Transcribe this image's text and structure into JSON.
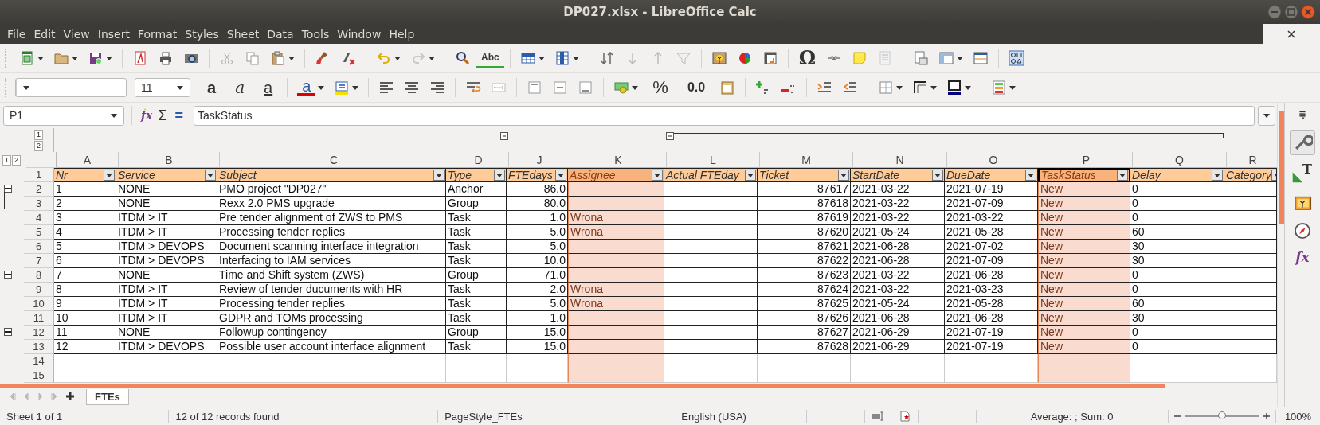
{
  "window": {
    "title": "DP027.xlsx - LibreOffice Calc"
  },
  "menu": [
    "File",
    "Edit",
    "View",
    "Insert",
    "Format",
    "Styles",
    "Sheet",
    "Data",
    "Tools",
    "Window",
    "Help"
  ],
  "standard_toolbar": {
    "glyphs": [
      "Abc",
      "Ω"
    ]
  },
  "formatting_toolbar": {
    "font_size": "11",
    "glyphs": [
      "a",
      "a",
      "a",
      "a",
      "%",
      "0.0"
    ]
  },
  "formula_bar": {
    "name_box": "P1",
    "glyphs": [
      "fx",
      "Σ",
      "="
    ],
    "content": "TaskStatus"
  },
  "outline_levels": {
    "columns": [
      "1",
      "2"
    ],
    "rows": [
      "1",
      "2"
    ]
  },
  "table": {
    "columns": [
      {
        "letter": "A",
        "header": "Nr",
        "numeric": false,
        "highlighted": false,
        "selected": false
      },
      {
        "letter": "B",
        "header": "Service",
        "numeric": false,
        "highlighted": false,
        "selected": false
      },
      {
        "letter": "C",
        "header": "Subject",
        "numeric": false,
        "highlighted": false,
        "selected": false
      },
      {
        "letter": "D",
        "header": "Type",
        "numeric": false,
        "highlighted": false,
        "selected": false
      },
      {
        "letter": "J",
        "header": "FTEdays",
        "numeric": true,
        "highlighted": false,
        "selected": false,
        "group_toggle": true
      },
      {
        "letter": "K",
        "header": "Assignee",
        "numeric": false,
        "highlighted": true,
        "selected": false
      },
      {
        "letter": "L",
        "header": "Actual FTEday",
        "highlighted": false,
        "selected": false,
        "group_toggle": true,
        "group_line": true
      },
      {
        "letter": "M",
        "header": "Ticket",
        "numeric": true,
        "highlighted": false,
        "selected": false,
        "group_line": true
      },
      {
        "letter": "N",
        "header": "StartDate",
        "numeric": false,
        "highlighted": false,
        "selected": false,
        "group_line": true
      },
      {
        "letter": "O",
        "header": "DueDate",
        "numeric": false,
        "highlighted": false,
        "selected": false,
        "group_line": true
      },
      {
        "letter": "P",
        "header": "TaskStatus",
        "numeric": false,
        "highlighted": true,
        "selected": true,
        "group_line": true
      },
      {
        "letter": "Q",
        "header": "Delay",
        "numeric": false,
        "highlighted": false,
        "selected": false,
        "group_line": true
      },
      {
        "letter": "R",
        "header": "Category",
        "highlighted": false,
        "selected": false
      }
    ],
    "header_row": "1",
    "rows": [
      {
        "number": "2",
        "group_toggle": true,
        "cells": [
          "1",
          "NONE",
          "PMO project \"DP027\"",
          "Anchor",
          "86.0",
          "",
          "",
          "87617",
          "2021-03-22",
          "2021-07-19",
          "New",
          "0",
          ""
        ]
      },
      {
        "number": "3",
        "group_line": true,
        "cells": [
          "2",
          "NONE",
          "Rexx 2.0 PMS upgrade",
          "Group",
          "80.0",
          "",
          "",
          "87618",
          "2021-03-22",
          "2021-07-09",
          "New",
          "0",
          ""
        ]
      },
      {
        "number": "4",
        "cells": [
          "3",
          "ITDM > IT",
          "Pre tender alignment of ZWS to PMS",
          "Task",
          "1.0",
          "Wrona",
          "",
          "87619",
          "2021-03-22",
          "2021-03-22",
          "New",
          "0",
          ""
        ]
      },
      {
        "number": "5",
        "cells": [
          "4",
          "ITDM > IT",
          "Processing tender replies",
          "Task",
          "5.0",
          "Wrona",
          "",
          "87620",
          "2021-05-24",
          "2021-05-28",
          "New",
          "60",
          ""
        ]
      },
      {
        "number": "6",
        "cells": [
          "5",
          "ITDM > DEVOPS",
          "Document scanning interface integration",
          "Task",
          "5.0",
          "",
          "",
          "87621",
          "2021-06-28",
          "2021-07-02",
          "New",
          "30",
          ""
        ]
      },
      {
        "number": "7",
        "cells": [
          "6",
          "ITDM > DEVOPS",
          "Interfacing to IAM services",
          "Task",
          "10.0",
          "",
          "",
          "87622",
          "2021-06-28",
          "2021-07-09",
          "New",
          "30",
          ""
        ]
      },
      {
        "number": "8",
        "group_toggle": true,
        "cells": [
          "7",
          "NONE",
          "Time and Shift system (ZWS)",
          "Group",
          "71.0",
          "",
          "",
          "87623",
          "2021-03-22",
          "2021-06-28",
          "New",
          "0",
          ""
        ]
      },
      {
        "number": "9",
        "cells": [
          "8",
          "ITDM > IT",
          "Review of tender ducuments with HR",
          "Task",
          "2.0",
          "Wrona",
          "",
          "87624",
          "2021-03-22",
          "2021-03-23",
          "New",
          "0",
          ""
        ]
      },
      {
        "number": "10",
        "cells": [
          "9",
          "ITDM > IT",
          "Processing tender replies",
          "Task",
          "5.0",
          "Wrona",
          "",
          "87625",
          "2021-05-24",
          "2021-05-28",
          "New",
          "60",
          ""
        ]
      },
      {
        "number": "11",
        "cells": [
          "10",
          "ITDM > IT",
          "GDPR and TOMs processing",
          "Task",
          "1.0",
          "",
          "",
          "87626",
          "2021-06-28",
          "2021-06-28",
          "New",
          "30",
          ""
        ]
      },
      {
        "number": "12",
        "group_toggle": true,
        "cells": [
          "11",
          "NONE",
          "Followup contingency",
          "Group",
          "15.0",
          "",
          "",
          "87627",
          "2021-06-29",
          "2021-07-19",
          "New",
          "0",
          ""
        ]
      },
      {
        "number": "13",
        "cells": [
          "12",
          "ITDM > DEVOPS",
          "Possible user account interface alignment",
          "Task",
          "15.0",
          "",
          "",
          "87628",
          "2021-06-29",
          "2021-07-19",
          "New",
          "0",
          ""
        ]
      },
      {
        "number": "14"
      },
      {
        "number": "15"
      }
    ]
  },
  "sheet_tabs": [
    {
      "label": "FTEs",
      "selected": true
    }
  ],
  "sidebar": {
    "glyphs": [
      "T",
      "fx"
    ]
  },
  "status_bar": {
    "sheet": "Sheet 1 of 1",
    "records": "12 of 12 records found",
    "page_style": "PageStyle_FTEs",
    "language": "English (USA)",
    "sum": "Average: ; Sum: 0",
    "zoom": {
      "level": 0.5,
      "reading": "100%"
    }
  }
}
